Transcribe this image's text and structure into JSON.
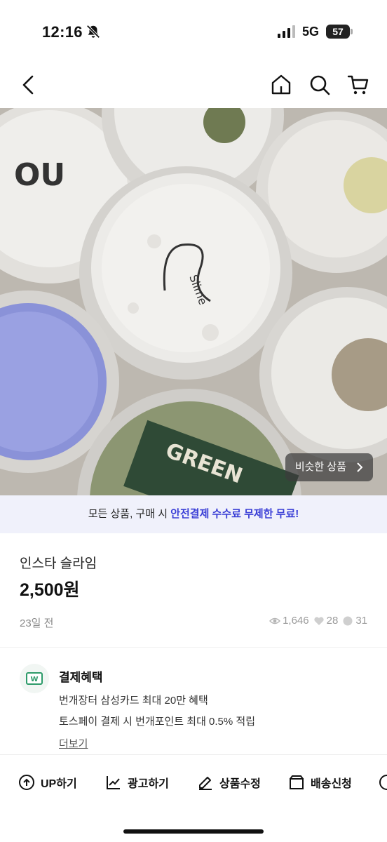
{
  "status_bar": {
    "time": "12:16",
    "network": "5G",
    "battery": "57"
  },
  "nav": {
    "icons": [
      "back-arrow-icon",
      "home-icon",
      "search-icon",
      "cart-icon"
    ]
  },
  "product": {
    "similar_button_label": "비슷한 상품",
    "title": "인스타 슬라임",
    "price": "2,500원",
    "posted": "23일 전",
    "views": "1,646",
    "likes": "28",
    "chats": "31"
  },
  "banner": {
    "prefix": "모든 상품, 구매 시 ",
    "highlight": "안전결제 수수료 무제한 무료!"
  },
  "benefit": {
    "title": "결제혜택",
    "line1": "번개장터 삼성카드 최대 20만 혜택",
    "line2": "토스페이 결제 시 번개포인트 최대 0.5% 적립",
    "more": "더보기"
  },
  "toolbar": {
    "up": "UP하기",
    "ad": "광고하기",
    "edit": "상품수정",
    "delivery": "배송신청"
  },
  "colors": {
    "accent": "#3a3fd6",
    "banner_bg": "#f0f1fb",
    "benefit_green": "#2e9b6a"
  }
}
